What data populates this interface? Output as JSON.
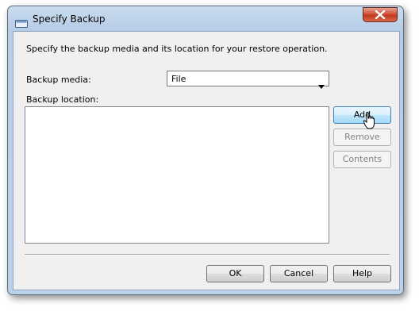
{
  "dialog": {
    "title": "Specify Backup",
    "description": "Specify the backup media and its location for your restore operation.",
    "backup_media_label": "Backup media:",
    "backup_media_value": "File",
    "backup_location_label": "Backup location:",
    "backup_locations": [],
    "side_buttons": {
      "add": "Add",
      "remove": "Remove",
      "contents": "Contents"
    },
    "footer_buttons": {
      "ok": "OK",
      "cancel": "Cancel",
      "help": "Help"
    }
  },
  "colors": {
    "close_button": "#c23a1f",
    "frame": "#bcd2ea",
    "client_bg": "#f0f0f0",
    "hover_border": "#3c7fb1"
  },
  "icons": [
    "window-icon",
    "close-icon",
    "dropdown-arrow-icon",
    "mouse-cursor-icon"
  ]
}
